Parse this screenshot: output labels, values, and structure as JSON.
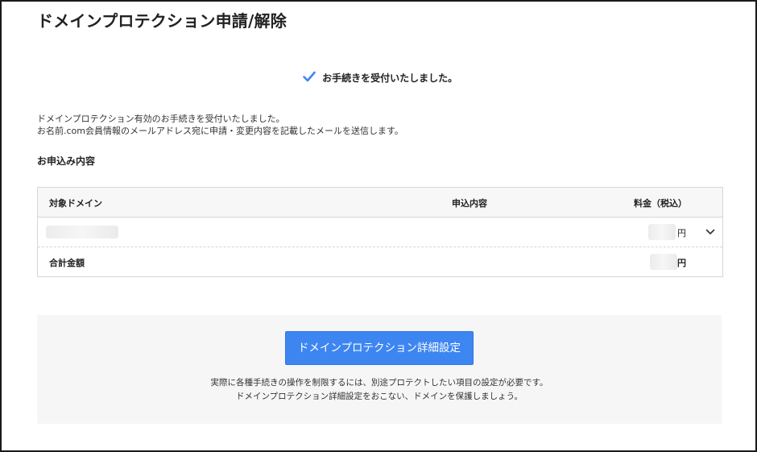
{
  "page": {
    "title": "ドメインプロテクション申請/解除"
  },
  "status": {
    "message": "お手続きを受付いたしました。"
  },
  "description": {
    "line1": "ドメインプロテクション有効のお手続きを受付いたしました。",
    "line2": "お名前.com会員情報のメールアドレス宛に申請・変更内容を記載したメールを送信します。"
  },
  "order": {
    "section_title": "お申込み内容",
    "columns": {
      "domain": "対象ドメイン",
      "content": "申込内容",
      "fee": "料金（税込）"
    },
    "item": {
      "yen": "円"
    },
    "total": {
      "label": "合計金額",
      "yen": "円"
    }
  },
  "cta": {
    "button_label": "ドメインプロテクション詳細設定",
    "note_line1": "実際に各種手続きの操作を制限するには、別途プロテクトしたい項目の設定が必要です。",
    "note_line2": "ドメインプロテクション詳細設定をおこない、ドメインを保護しましょう。"
  },
  "colors": {
    "accent": "#3d86f2",
    "check": "#3d86f2"
  },
  "icons": {
    "status": "check-icon",
    "expand": "chevron-down-icon"
  }
}
